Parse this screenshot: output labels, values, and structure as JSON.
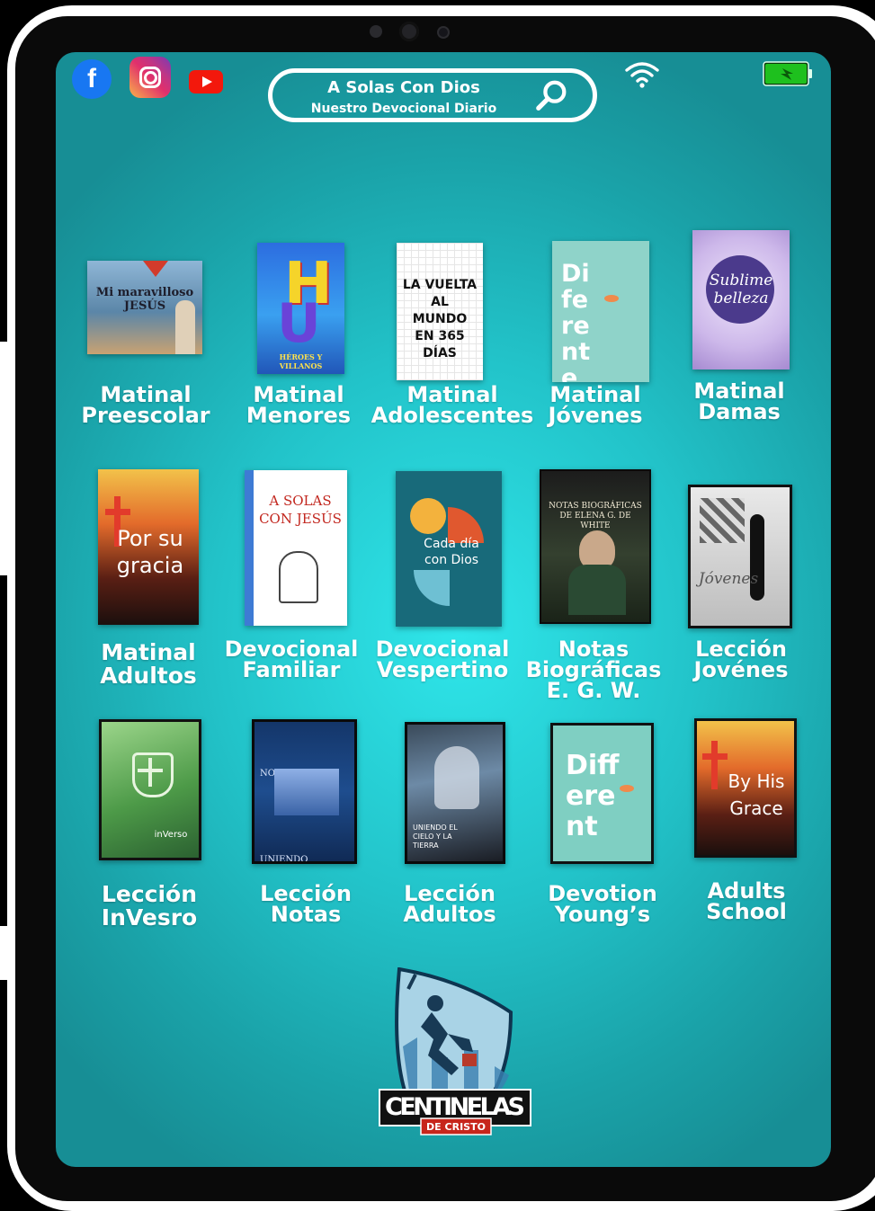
{
  "header": {
    "search_title": "A Solas Con Dios",
    "search_subtitle": "Nuestro Devocional Diario",
    "facebook_glyph": "f",
    "icons": [
      "facebook-icon",
      "instagram-icon",
      "youtube-icon",
      "search-icon",
      "wifi-icon",
      "battery-charging-icon"
    ]
  },
  "books": [
    {
      "line1": "Matinal",
      "line2": "Preescolar",
      "cover_text": "Mi maravilloso JESÚS"
    },
    {
      "line1": "Matinal",
      "line2": "Menores",
      "cover_text": "HÉROES Y VILLANOS"
    },
    {
      "line1": "Matinal",
      "line2": "Adolescentes",
      "cover_text": "LA VUELTA AL MUNDO EN 365 DÍAS"
    },
    {
      "line1": "Matinal",
      "line2": "Jóvenes",
      "cover_text": "Diferente"
    },
    {
      "line1": "Matinal",
      "line2": "Damas",
      "cover_text": "Sublime belleza"
    },
    {
      "line1": "Matinal",
      "line2": "Adultos",
      "cover_text": "Por su gracia"
    },
    {
      "line1": "Devocional",
      "line2": "Familiar",
      "cover_text": "A SOLAS CON JESÚS"
    },
    {
      "line1": "Devocional",
      "line2": "Vespertino",
      "cover_text": "Cada día con Dios"
    },
    {
      "line1": "Notas",
      "line2": "Biográficas",
      "line3": "E. G. W.",
      "cover_text": "NOTAS BIOGRÁFICAS DE ELENA G. DE WHITE"
    },
    {
      "line1": "Lección",
      "line2": "Jovénes",
      "cover_text": "Jóvenes"
    },
    {
      "line1": "Lección",
      "line2": "InVesro",
      "cover_text": "inVerso"
    },
    {
      "line1": "Lección",
      "line2": "Notas",
      "cover_text": "NOTAS UNIENDO"
    },
    {
      "line1": "Lección",
      "line2": "Adultos",
      "cover_text": "UNIENDO EL CIELO Y LA TIERRA"
    },
    {
      "line1": "Devotion",
      "line2": "Young’s",
      "cover_text": "Different"
    },
    {
      "line1": "Adults",
      "line2": "School",
      "cover_text": "By His Grace"
    }
  ],
  "logo": {
    "main": "CENTINELAS",
    "sub": "DE CRISTO"
  },
  "colors": {
    "screen": "#22c3c9",
    "accent_search": "#ffffff",
    "facebook": "#1877f2",
    "youtube": "#f3180c"
  }
}
